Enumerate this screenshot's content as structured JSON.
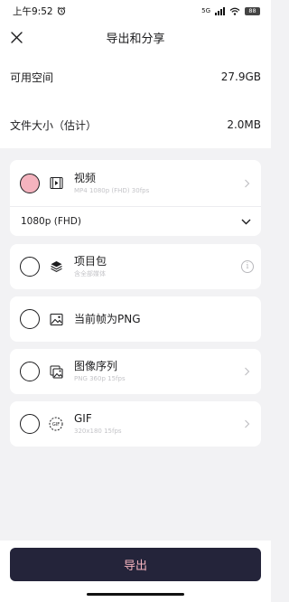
{
  "status_bar": {
    "time": "上午9:52",
    "signal": "5G",
    "battery": "88"
  },
  "header": {
    "title": "导出和分享"
  },
  "info": [
    {
      "label": "可用空间",
      "value": "27.9GB"
    },
    {
      "label": "文件大小（估计）",
      "value": "2.0MB"
    }
  ],
  "options": {
    "video": {
      "title": "视频",
      "subtitle": "MP4 1080p (FHD) 30fps",
      "selected": true,
      "icon": "video-icon"
    },
    "resolution": {
      "value": "1080p (FHD)"
    },
    "project": {
      "title": "项目包",
      "subtitle": "含全部媒体",
      "icon": "project-package-icon"
    },
    "png": {
      "title": "当前帧为PNG",
      "icon": "image-icon"
    },
    "sequence": {
      "title": "图像序列",
      "subtitle": "PNG 360p 15fps",
      "icon": "image-sequence-icon"
    },
    "gif": {
      "title": "GIF",
      "subtitle": "320x180 15fps",
      "icon": "gif-icon"
    }
  },
  "export_button": "导出",
  "colors": {
    "accent": "#f4b3be",
    "button_bg": "#24243a"
  }
}
